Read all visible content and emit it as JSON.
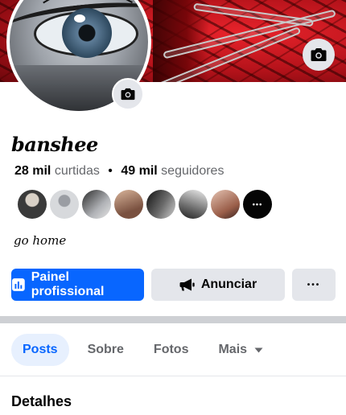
{
  "profile": {
    "name": "banshee",
    "likes_count": "28 mil",
    "likes_label": "curtidas",
    "separator": "•",
    "followers_count": "49 mil",
    "followers_label": "seguidores",
    "bio": "go home"
  },
  "follower_avatars": [
    {
      "name": "follower-avatar-1",
      "color": "#3a3a3a"
    },
    {
      "name": "follower-avatar-2",
      "color": "#c8cace"
    },
    {
      "name": "follower-avatar-3",
      "color": "#8d8f93"
    },
    {
      "name": "follower-avatar-4",
      "color": "#b58d73"
    },
    {
      "name": "follower-avatar-5",
      "color": "#2d2d2d"
    },
    {
      "name": "follower-avatar-6",
      "color": "#9a9a9a"
    },
    {
      "name": "follower-avatar-7",
      "color": "#c59a86"
    }
  ],
  "follower_more_label": "•••",
  "actions": {
    "professional_panel": "Painel profissional",
    "advertise": "Anunciar",
    "more": "•••"
  },
  "tabs": [
    {
      "label": "Posts",
      "active": true
    },
    {
      "label": "Sobre",
      "active": false
    },
    {
      "label": "Fotos",
      "active": false
    },
    {
      "label": "Mais",
      "active": false
    }
  ],
  "section": {
    "title": "Detalhes"
  },
  "icons": {
    "cover_camera": "camera-icon",
    "avatar_camera": "camera-icon",
    "professional_panel": "bar-chart-icon",
    "advertise": "megaphone-icon",
    "tab_more": "caret-down-icon"
  },
  "colors": {
    "primary": "#0866ff",
    "secondary_button": "#e4e6eb",
    "active_tab_bg": "#e7f0fe",
    "muted_text": "#65676b"
  }
}
